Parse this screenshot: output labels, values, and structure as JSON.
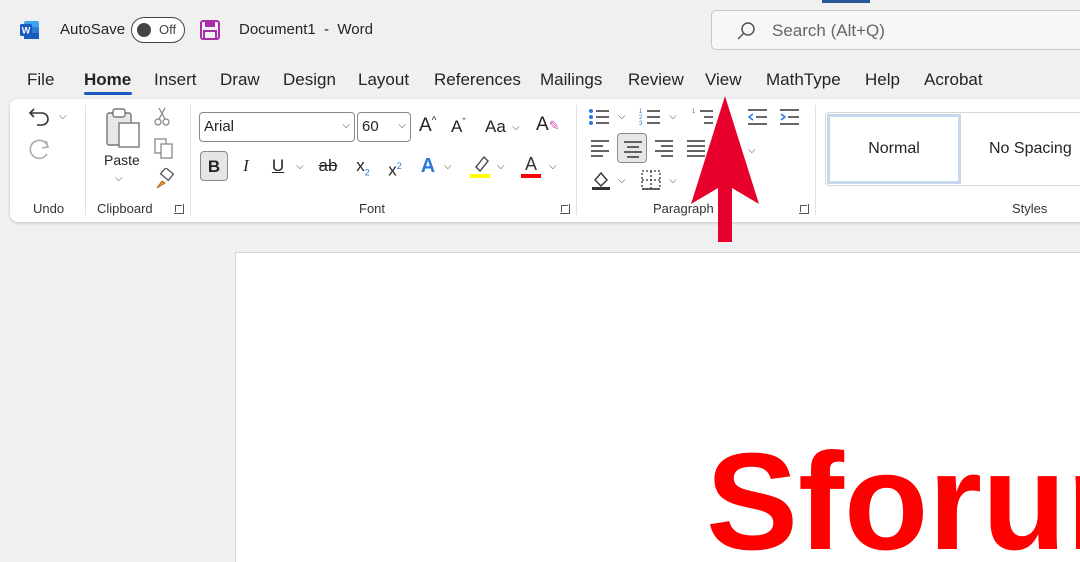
{
  "titlebar": {
    "autosave_label": "AutoSave",
    "autosave_state": "Off",
    "document_title": "Document1  -  Word",
    "search_placeholder": "Search (Alt+Q)",
    "brand_color": "#2b579a"
  },
  "menu": {
    "tabs": [
      "File",
      "Home",
      "Insert",
      "Draw",
      "Design",
      "Layout",
      "References",
      "Mailings",
      "Review",
      "View",
      "MathType",
      "Help",
      "Acrobat"
    ],
    "active": "Home"
  },
  "ribbon": {
    "undo": {
      "label": "Undo"
    },
    "clipboard": {
      "label": "Clipboard",
      "paste_label": "Paste"
    },
    "font": {
      "label": "Font",
      "font_name": "Arial",
      "font_size": "60",
      "case_label": "Aa",
      "bold": "B",
      "italic": "I",
      "underline": "U",
      "strikethrough": "ab",
      "subscript": "x",
      "subscript_mark": "2",
      "superscript": "x",
      "superscript_mark": "2",
      "highlight_color": "#ffff00",
      "font_color": "#ff0000"
    },
    "paragraph": {
      "label": "Paragraph"
    },
    "styles": {
      "label": "Styles",
      "items": [
        "Normal",
        "No Spacing"
      ]
    }
  },
  "document": {
    "text": "Sforum",
    "text_color": "#ff0000"
  },
  "annotation": {
    "arrow_color": "#e8002d"
  }
}
